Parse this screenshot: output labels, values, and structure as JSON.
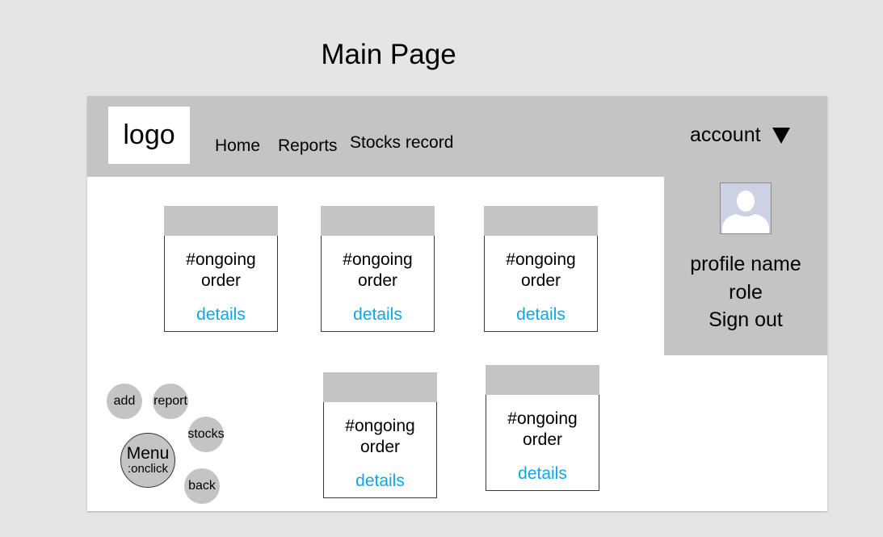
{
  "page": {
    "title": "Main Page"
  },
  "header": {
    "logo": "logo",
    "nav": [
      "Home",
      "Reports",
      "Stocks record"
    ],
    "account": "account"
  },
  "account_panel": {
    "avatar_icon": "user-avatar-icon",
    "profile_name": "profile name",
    "role": "role",
    "sign_out": "Sign out"
  },
  "cards": [
    {
      "line1": "#ongoing",
      "line2": "order",
      "link": "details"
    },
    {
      "line1": "#ongoing",
      "line2": "order",
      "link": "details"
    },
    {
      "line1": "#ongoing",
      "line2": "order",
      "link": "details"
    },
    {
      "line1": "#ongoing",
      "line2": "order",
      "link": "details"
    },
    {
      "line1": "#ongoing",
      "line2": "order",
      "link": "details"
    }
  ],
  "fab_menu": {
    "menu": "Menu",
    "menu_hint": ":onclick",
    "add": "add",
    "report": "report",
    "stocks": "stocks",
    "back": "back"
  },
  "colors": {
    "bar": "#c4c4c4",
    "link": "#0ba7e9",
    "background": "#e5e5e5"
  }
}
